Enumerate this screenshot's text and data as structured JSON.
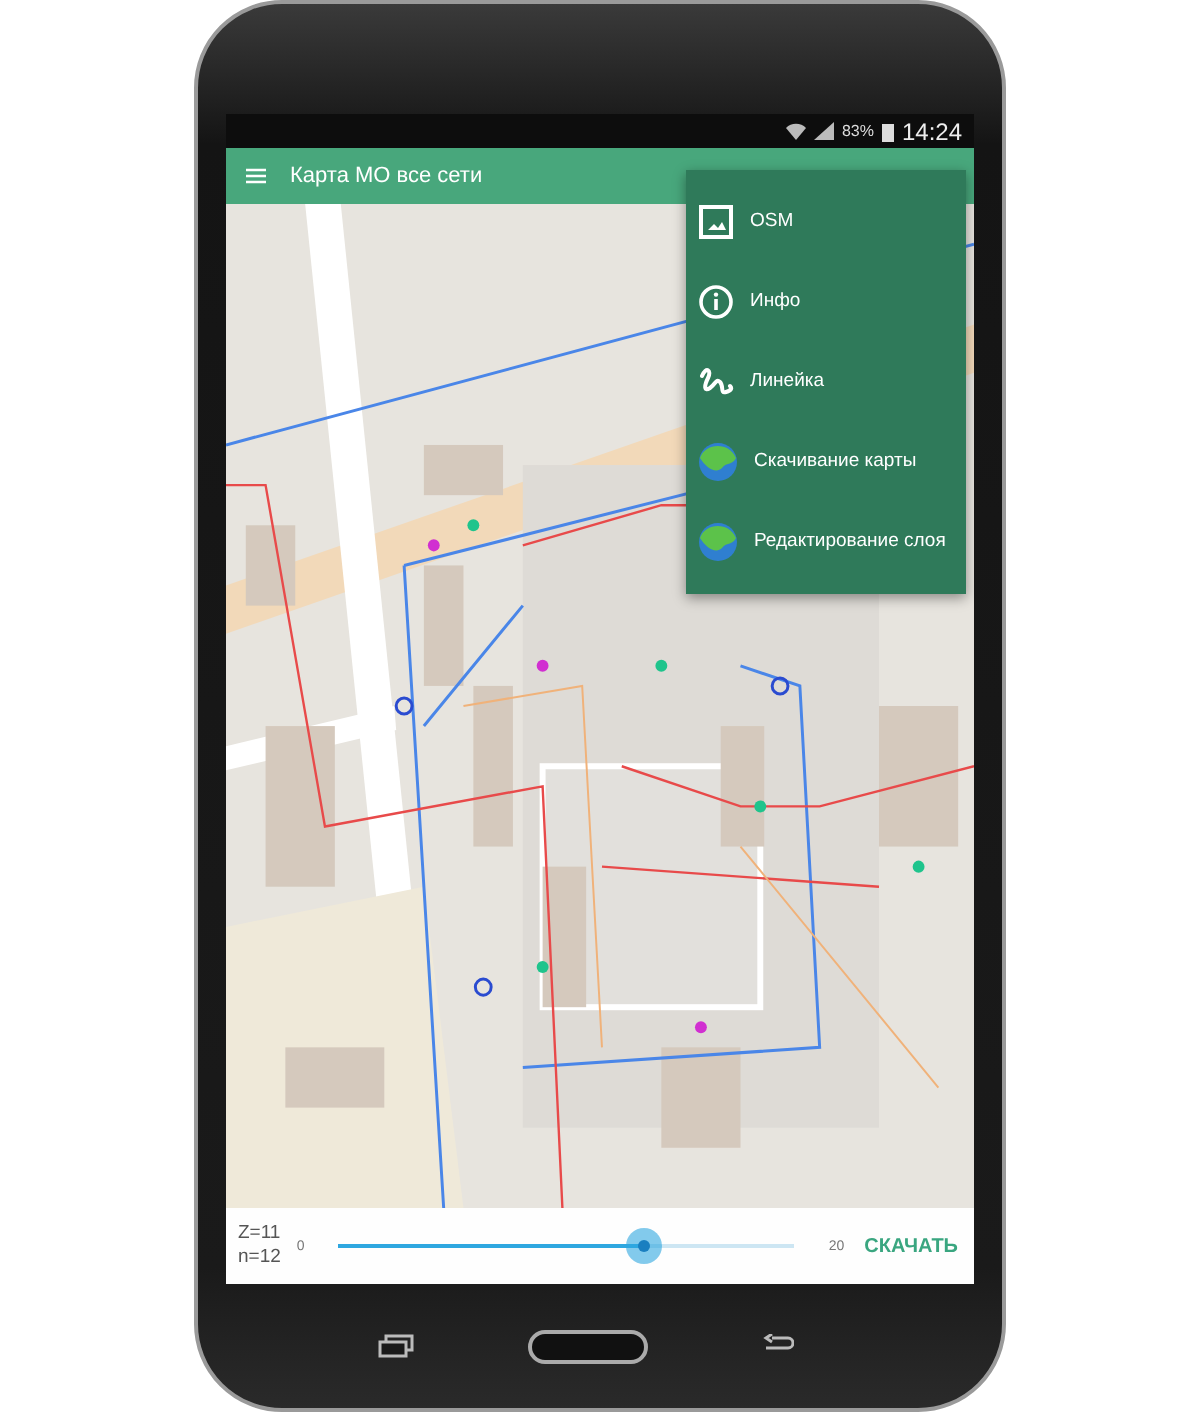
{
  "status_bar": {
    "battery": "83%",
    "time": "14:24"
  },
  "app_bar": {
    "title": "Карта МО все сети"
  },
  "menu": {
    "items": [
      {
        "kind": "image",
        "label": "OSM"
      },
      {
        "kind": "info",
        "label": "Инфо"
      },
      {
        "kind": "ruler",
        "label": "Линейка"
      },
      {
        "kind": "globe",
        "label": "Скачивание карты"
      },
      {
        "kind": "globe",
        "label": "Редактирование слоя"
      }
    ]
  },
  "download_bar": {
    "zoom": "Z=11",
    "count": "n=12",
    "min": "0",
    "max": "20",
    "level": 0.67,
    "button": "СКАЧАТЬ"
  }
}
